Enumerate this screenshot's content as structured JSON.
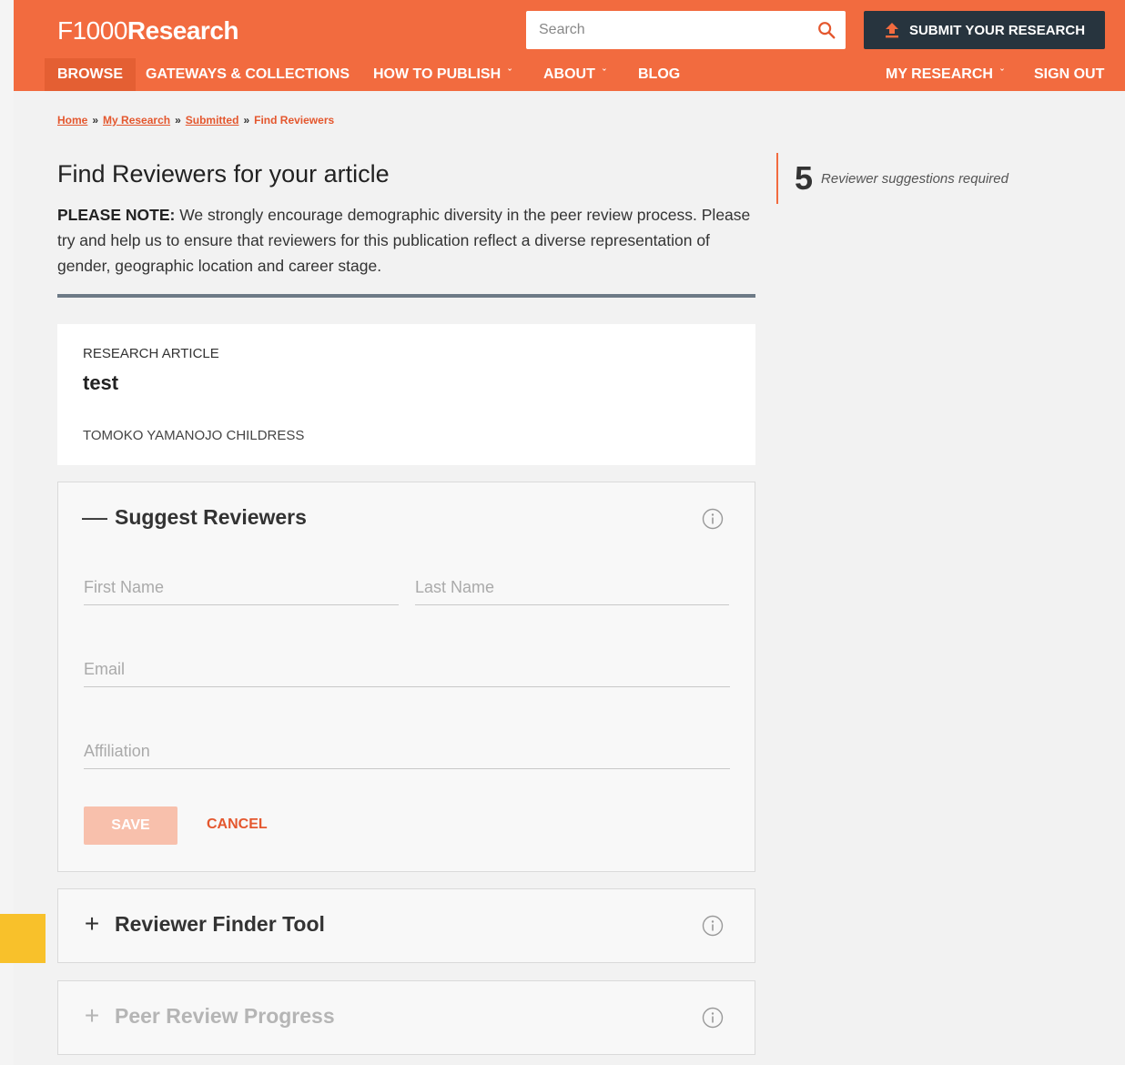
{
  "header": {
    "logo_prefix": "F1000",
    "logo_suffix": "Research",
    "search_placeholder": "Search",
    "submit_label": "SUBMIT YOUR RESEARCH"
  },
  "nav": {
    "browse": "BROWSE",
    "gateways": "GATEWAYS & COLLECTIONS",
    "how_to_publish": "HOW TO PUBLISH",
    "about": "ABOUT",
    "blog": "BLOG",
    "my_research": "MY RESEARCH",
    "sign_out": "SIGN OUT"
  },
  "breadcrumb": {
    "home": "Home",
    "my_research": "My Research",
    "submitted": "Submitted",
    "current": "Find Reviewers",
    "separator": "»"
  },
  "page": {
    "title": "Find Reviewers for your article",
    "note_bold": "PLEASE NOTE:",
    "note_text": " We strongly encourage demographic diversity in the peer review process. Please try and help us to ensure that reviewers for this publication reflect a diverse representation of gender, geographic location and career stage."
  },
  "sidebar": {
    "count": "5",
    "label": "Reviewer suggestions required"
  },
  "article": {
    "type": "RESEARCH ARTICLE",
    "title": "test",
    "author": "TOMOKO YAMANOJO CHILDRESS"
  },
  "suggest_panel": {
    "toggle": "—",
    "title": "Suggest Reviewers",
    "first_name_placeholder": "First Name",
    "last_name_placeholder": "Last Name",
    "email_placeholder": "Email",
    "affiliation_placeholder": "Affiliation",
    "save_label": "SAVE",
    "cancel_label": "CANCEL"
  },
  "finder_panel": {
    "toggle": "+",
    "title": "Reviewer Finder Tool"
  },
  "progress_panel": {
    "toggle": "+",
    "title": "Peer Review Progress"
  },
  "colors": {
    "brand": "#f26b3f",
    "dark": "#27343e",
    "accent_text": "#e4572e"
  }
}
